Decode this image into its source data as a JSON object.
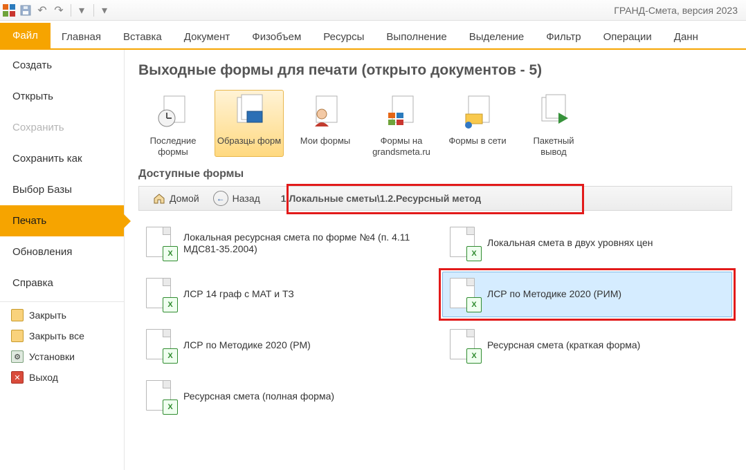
{
  "app": {
    "title": "ГРАНД-Смета, версия 2023"
  },
  "ribbon": {
    "file": "Файл",
    "tabs": [
      "Главная",
      "Вставка",
      "Документ",
      "Физобъем",
      "Ресурсы",
      "Выполнение",
      "Выделение",
      "Фильтр",
      "Операции",
      "Данн"
    ]
  },
  "sidebar": {
    "create": "Создать",
    "open": "Открыть",
    "save": "Сохранить",
    "save_as": "Сохранить как",
    "choose_db": "Выбор Базы",
    "print": "Печать",
    "updates": "Обновления",
    "help": "Справка",
    "close": "Закрыть",
    "close_all": "Закрыть все",
    "settings": "Установки",
    "exit": "Выход"
  },
  "content": {
    "heading": "Выходные формы для печати (открыто документов - 5)",
    "tools": {
      "recent": "Последние формы",
      "samples": "Образцы форм",
      "my": "Мои формы",
      "grand": "Формы на grandsmeta.ru",
      "net": "Формы в сети",
      "batch": "Пакетный вывод"
    },
    "available": "Доступные формы",
    "crumb": {
      "home": "Домой",
      "back": "Назад",
      "path": "1.Локальные сметы\\1.2.Ресурсный метод"
    },
    "files": {
      "f1": "Локальная ресурсная смета по форме №4 (п. 4.11 МДС81-35.2004)",
      "f2": "Локальная смета в двух уровнях цен",
      "f3": "ЛСР 14 граф с МАТ и ТЗ",
      "f4": "ЛСР по Методике 2020 (РИМ)",
      "f5": "ЛСР по Методике 2020 (РМ)",
      "f6": "Ресурсная смета (краткая форма)",
      "f7": "Ресурсная смета (полная форма)"
    }
  }
}
